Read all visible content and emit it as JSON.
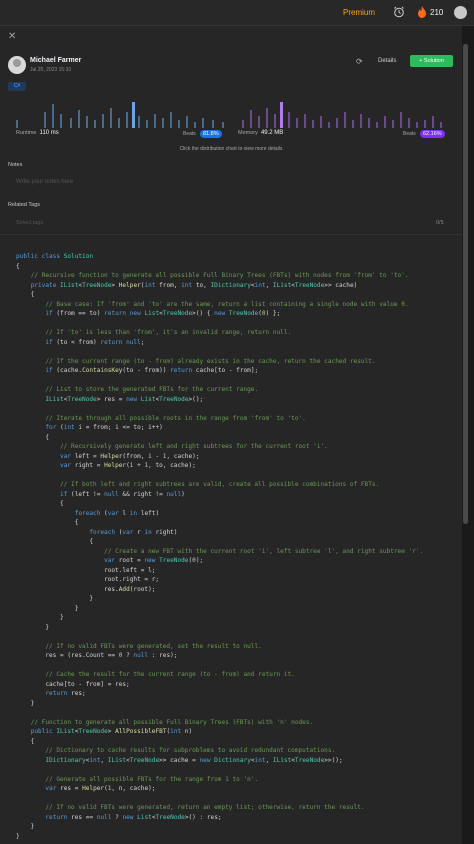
{
  "topbar": {
    "premium_label": "Premium",
    "streak_count": "210",
    "icons": [
      "alarm-icon",
      "fire-icon",
      "user-avatar"
    ]
  },
  "panel": {
    "close_label": "✕",
    "author": {
      "name": "Michael Farmer",
      "date": "Jul 25, 2023 15:10"
    },
    "details_label": "Details",
    "solution_label": "+ Solution",
    "language_badge": "C#"
  },
  "stats": {
    "runtime_label": "Runtime",
    "runtime_value": "110 ms",
    "runtime_beats_label": "Beats",
    "runtime_beats": "81.8%",
    "memory_label": "Memory",
    "memory_value": "49.2 MB",
    "memory_beats_label": "Beats",
    "memory_beats": "62.16%",
    "hint": "Click the distribution chart to view more details"
  },
  "notes": {
    "label": "Notes",
    "placeholder": "Write your notes here"
  },
  "tags": {
    "label": "Related Tags",
    "placeholder": "Select tags",
    "count": "0/5"
  },
  "colors": {
    "accent_blue": "#1a73e8",
    "accent_purple": "#7b2ff7",
    "green": "#2cbb5d",
    "orange": "#ffa116"
  }
}
